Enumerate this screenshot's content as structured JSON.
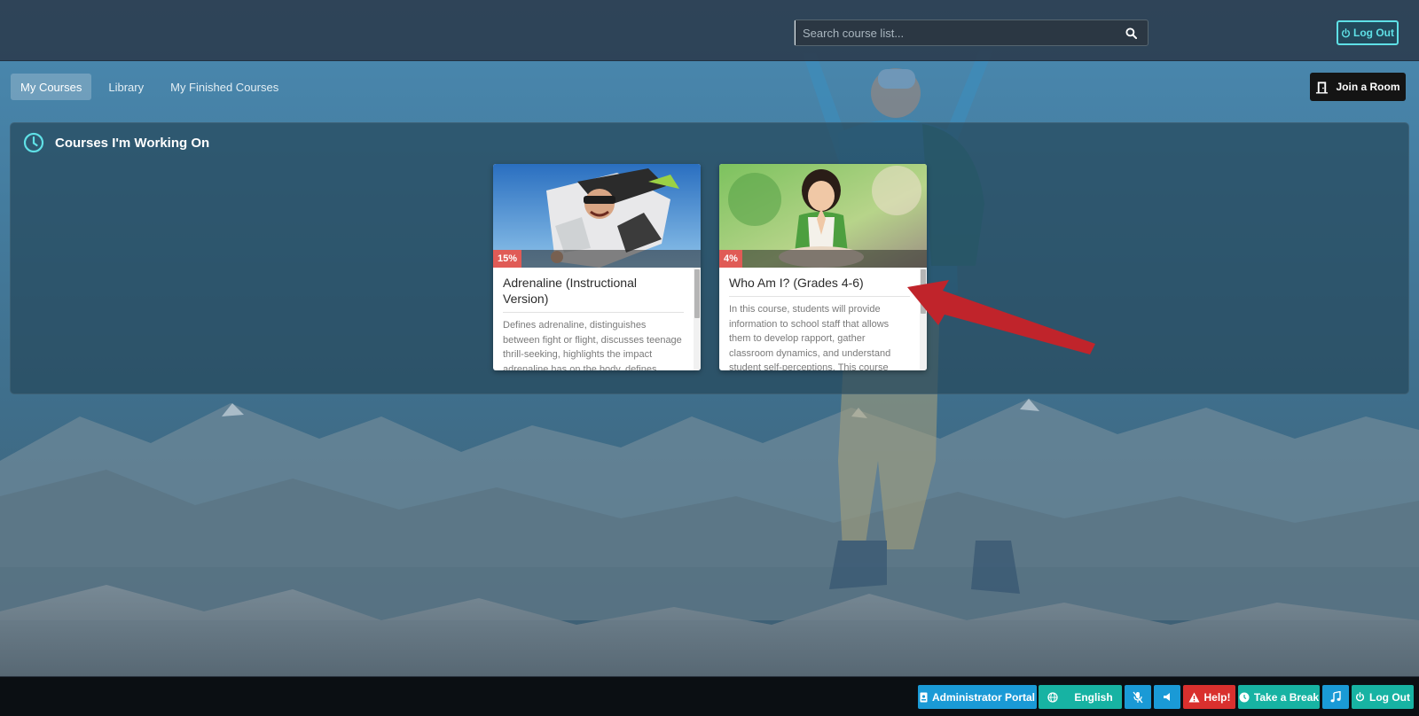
{
  "header": {
    "search_placeholder": "Search course list...",
    "search_value": "",
    "logout_label": "Log Out"
  },
  "nav": {
    "tabs": [
      {
        "label": "My Courses",
        "active": true
      },
      {
        "label": "Library",
        "active": false
      },
      {
        "label": "My Finished Courses",
        "active": false
      }
    ],
    "join_room_label": "Join a Room"
  },
  "panel": {
    "title": "Courses I'm Working On",
    "courses": [
      {
        "progress": "15%",
        "title": "Adrenaline (Instructional Version)",
        "description": "Defines adrenaline, distinguishes between fight or flight, discusses teenage thrill-seeking, highlights the impact adrenaline has on the body, defines..."
      },
      {
        "progress": "4%",
        "title": "Who Am I? (Grades 4-6)",
        "description": "In this course, students will provide information to school staff that allows them to develop rapport, gather classroom dynamics, and understand student self-perceptions. This course can..."
      }
    ]
  },
  "footer": {
    "admin_portal": "Administrator Portal",
    "language": "English",
    "help": "Help!",
    "take_break": "Take a Break",
    "logout": "Log Out"
  },
  "colors": {
    "accent_cyan": "#5fe0e6",
    "btn_blue": "#1a9ad6",
    "btn_teal": "#17b3a3",
    "btn_red": "#d9302e",
    "progress_red": "#e05b56",
    "arrow_red": "#c0242b"
  }
}
